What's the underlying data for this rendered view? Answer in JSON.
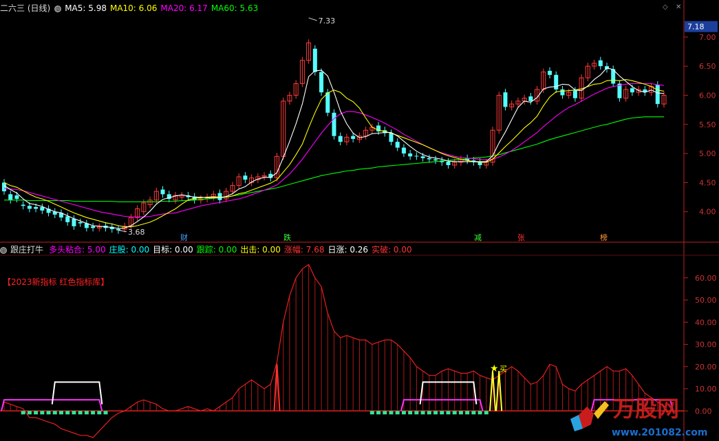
{
  "main_header": {
    "stock": "二六三 (日线)",
    "ma5_label": "MA5: 5.98",
    "ma10_label": "MA10: 6.06",
    "ma20_label": "MA20: 6.17",
    "ma60_label": "MA60: 5.63",
    "colors": {
      "ma5": "#ffffff",
      "ma10": "#ffff00",
      "ma20": "#ff00ff",
      "ma60": "#00ff00"
    }
  },
  "price_axis": {
    "current_price": "7.18",
    "ticks": [
      "7.00",
      "6.50",
      "6.00",
      "5.50",
      "5.00",
      "4.50",
      "4.00"
    ],
    "tick_values": [
      7.0,
      6.5,
      6.0,
      5.5,
      5.0,
      4.5,
      4.0
    ]
  },
  "price_annotations": {
    "high": "7.33",
    "low": "3.68"
  },
  "event_tags": [
    {
      "text": "财",
      "color": "#3fa7ff"
    },
    {
      "text": "跌",
      "color": "#33ff33"
    },
    {
      "text": "减",
      "color": "#33ff33"
    },
    {
      "text": "张",
      "color": "#ff3333"
    },
    {
      "text": "榜",
      "color": "#ff9933"
    }
  ],
  "indicator_header": {
    "name": "跟庄打牛",
    "items": [
      {
        "label": "多头粘合: 5.00",
        "color": "#ff00ff"
      },
      {
        "label": "庄股: 0.00",
        "color": "#00ffff"
      },
      {
        "label": "目标: 0.00",
        "color": "#ffffff"
      },
      {
        "label": "跟踪: 0.00",
        "color": "#00ff00"
      },
      {
        "label": "出击: 0.00",
        "color": "#ffff00"
      },
      {
        "label": "涨幅: 7.68",
        "color": "#ff3333"
      },
      {
        "label": "日涨: 0.26",
        "color": "#ffffff"
      },
      {
        "label": "实破: 0.00",
        "color": "#ff3333"
      }
    ]
  },
  "indicator_note": "【2023新指标 红色指标库】",
  "indicator_axis": {
    "ticks": [
      "60.00",
      "50.00",
      "40.00",
      "30.00",
      "20.00",
      "10.00",
      "0.00"
    ],
    "tick_values": [
      60,
      50,
      40,
      30,
      20,
      10,
      0
    ]
  },
  "buy_label": "买",
  "watermark": {
    "text": "万股网",
    "url": "www.201082.com"
  },
  "chart_data": {
    "type": "candlestick",
    "price_range": [
      3.5,
      7.4
    ],
    "indicator_range": [
      -12,
      68
    ],
    "close": [
      4.35,
      4.2,
      4.22,
      4.1,
      4.05,
      4.05,
      4.02,
      3.98,
      3.95,
      3.9,
      3.82,
      3.75,
      3.8,
      3.72,
      3.72,
      3.74,
      3.72,
      3.7,
      3.68,
      3.75,
      3.9,
      4.05,
      4.15,
      4.2,
      4.35,
      4.3,
      4.22,
      4.28,
      4.28,
      4.25,
      4.2,
      4.22,
      4.25,
      4.3,
      4.2,
      4.35,
      4.45,
      4.6,
      4.55,
      4.58,
      4.6,
      4.62,
      4.58,
      4.95,
      5.9,
      6.0,
      6.2,
      6.6,
      6.9,
      6.4,
      6.05,
      5.7,
      5.3,
      5.2,
      5.28,
      5.25,
      5.3,
      5.4,
      5.45,
      5.38,
      5.35,
      5.2,
      5.1,
      5.0,
      4.95,
      4.95,
      4.92,
      4.9,
      4.88,
      4.85,
      4.8,
      4.85,
      4.9,
      4.88,
      4.85,
      4.8,
      4.85,
      5.4,
      6.0,
      5.8,
      5.85,
      5.9,
      5.95,
      5.9,
      6.1,
      6.4,
      6.35,
      6.1,
      6.0,
      6.05,
      5.95,
      6.3,
      6.5,
      6.55,
      6.5,
      6.45,
      6.2,
      5.95,
      6.1,
      6.05,
      6.1,
      6.05,
      6.15,
      5.85,
      6.0
    ],
    "open": [
      4.5,
      4.3,
      4.28,
      4.12,
      4.1,
      4.08,
      4.08,
      4.05,
      4.0,
      3.98,
      3.92,
      3.88,
      3.82,
      3.8,
      3.75,
      3.72,
      3.76,
      3.74,
      3.7,
      3.7,
      3.75,
      3.9,
      4.0,
      4.12,
      4.2,
      4.38,
      4.3,
      4.2,
      4.25,
      4.28,
      4.26,
      4.2,
      4.22,
      4.25,
      4.32,
      4.22,
      4.35,
      4.45,
      4.62,
      4.5,
      4.55,
      4.6,
      4.65,
      4.58,
      4.95,
      5.9,
      6.0,
      6.2,
      6.6,
      6.8,
      6.4,
      6.05,
      5.7,
      5.3,
      5.2,
      5.3,
      5.24,
      5.3,
      5.4,
      5.48,
      5.4,
      5.35,
      5.2,
      5.1,
      5.0,
      4.96,
      4.95,
      4.92,
      4.9,
      4.88,
      4.86,
      4.8,
      4.85,
      4.92,
      4.88,
      4.86,
      4.8,
      4.85,
      5.4,
      6.05,
      5.8,
      5.85,
      5.9,
      5.98,
      5.9,
      6.1,
      6.42,
      6.35,
      6.1,
      6.0,
      6.08,
      5.95,
      6.3,
      6.5,
      6.6,
      6.5,
      6.45,
      6.2,
      5.95,
      6.12,
      6.05,
      6.1,
      6.05,
      6.18,
      5.85
    ],
    "ma5": [
      4.45,
      4.38,
      4.32,
      4.22,
      4.14,
      4.12,
      4.09,
      4.04,
      4.0,
      3.98,
      3.93,
      3.88,
      3.84,
      3.8,
      3.76,
      3.75,
      3.74,
      3.73,
      3.71,
      3.72,
      3.76,
      3.83,
      3.91,
      4.01,
      4.13,
      4.21,
      4.24,
      4.27,
      4.29,
      4.27,
      4.25,
      4.25,
      4.24,
      4.24,
      4.24,
      4.26,
      4.31,
      4.39,
      4.43,
      4.51,
      4.56,
      4.59,
      4.59,
      4.67,
      4.93,
      5.21,
      5.51,
      5.85,
      6.32,
      6.42,
      6.43,
      6.33,
      6.05,
      5.73,
      5.51,
      5.35,
      5.27,
      5.29,
      5.34,
      5.35,
      5.36,
      5.36,
      5.3,
      5.21,
      5.12,
      5.04,
      4.98,
      4.94,
      4.92,
      4.9,
      4.87,
      4.86,
      4.86,
      4.86,
      4.86,
      4.86,
      4.86,
      4.96,
      5.18,
      5.37,
      5.58,
      5.79,
      5.9,
      5.88,
      5.96,
      6.11,
      6.14,
      6.15,
      6.19,
      6.18,
      6.09,
      6.08,
      6.16,
      6.27,
      6.35,
      6.47,
      6.44,
      6.33,
      6.24,
      6.15,
      6.08,
      6.05,
      6.09,
      6.04,
      6.03
    ],
    "ma10": [
      4.5,
      4.45,
      4.42,
      4.36,
      4.3,
      4.25,
      4.22,
      4.18,
      4.13,
      4.08,
      4.03,
      3.98,
      3.94,
      3.9,
      3.87,
      3.84,
      3.81,
      3.79,
      3.76,
      3.74,
      3.74,
      3.76,
      3.79,
      3.82,
      3.87,
      3.93,
      3.99,
      4.05,
      4.13,
      4.2,
      4.23,
      4.24,
      4.25,
      4.26,
      4.25,
      4.25,
      4.27,
      4.31,
      4.33,
      4.37,
      4.41,
      4.45,
      4.49,
      4.55,
      4.68,
      4.81,
      4.98,
      5.16,
      5.44,
      5.7,
      5.93,
      6.04,
      6.09,
      6.05,
      5.95,
      5.89,
      5.78,
      5.61,
      5.45,
      5.4,
      5.38,
      5.35,
      5.31,
      5.27,
      5.23,
      5.19,
      5.15,
      5.1,
      5.05,
      5.0,
      4.96,
      4.93,
      4.9,
      4.88,
      4.86,
      4.85,
      4.85,
      4.9,
      5.01,
      5.12,
      5.22,
      5.33,
      5.44,
      5.53,
      5.64,
      5.82,
      5.97,
      6.06,
      6.07,
      6.08,
      6.09,
      6.11,
      6.15,
      6.19,
      6.2,
      6.25,
      6.26,
      6.25,
      6.27,
      6.25,
      6.22,
      6.19,
      6.15,
      6.09,
      6.07
    ],
    "ma20": [
      4.4,
      4.39,
      4.38,
      4.36,
      4.33,
      4.3,
      4.27,
      4.24,
      4.21,
      4.18,
      4.15,
      4.12,
      4.09,
      4.06,
      4.03,
      4.0,
      3.98,
      3.96,
      3.94,
      3.92,
      3.91,
      3.91,
      3.91,
      3.92,
      3.94,
      3.96,
      3.97,
      3.98,
      4.01,
      4.04,
      4.07,
      4.1,
      4.12,
      4.14,
      4.16,
      4.18,
      4.2,
      4.22,
      4.25,
      4.29,
      4.33,
      4.37,
      4.41,
      4.46,
      4.55,
      4.65,
      4.77,
      4.9,
      5.05,
      5.2,
      5.35,
      5.48,
      5.6,
      5.68,
      5.72,
      5.72,
      5.7,
      5.66,
      5.62,
      5.57,
      5.52,
      5.46,
      5.4,
      5.33,
      5.27,
      5.21,
      5.15,
      5.1,
      5.05,
      5.01,
      4.98,
      4.95,
      4.93,
      4.92,
      4.91,
      4.9,
      4.89,
      4.9,
      4.94,
      4.99,
      5.05,
      5.12,
      5.2,
      5.28,
      5.36,
      5.46,
      5.55,
      5.64,
      5.72,
      5.79,
      5.84,
      5.9,
      5.96,
      6.02,
      6.07,
      6.12,
      6.15,
      6.17,
      6.19,
      6.2,
      6.2,
      6.2,
      6.2,
      6.18,
      6.17
    ],
    "ma60": [
      4.2,
      4.2,
      4.2,
      4.2,
      4.19,
      4.19,
      4.19,
      4.19,
      4.19,
      4.19,
      4.19,
      4.18,
      4.18,
      4.18,
      4.18,
      4.18,
      4.18,
      4.18,
      4.17,
      4.17,
      4.17,
      4.17,
      4.17,
      4.17,
      4.17,
      4.18,
      4.18,
      4.18,
      4.19,
      4.19,
      4.2,
      4.21,
      4.22,
      4.23,
      4.24,
      4.25,
      4.27,
      4.29,
      4.31,
      4.33,
      4.35,
      4.37,
      4.39,
      4.41,
      4.44,
      4.47,
      4.5,
      4.53,
      4.56,
      4.59,
      4.62,
      4.64,
      4.66,
      4.68,
      4.7,
      4.71,
      4.73,
      4.74,
      4.75,
      4.77,
      4.78,
      4.79,
      4.8,
      4.81,
      4.82,
      4.83,
      4.84,
      4.85,
      4.86,
      4.87,
      4.88,
      4.89,
      4.9,
      4.91,
      4.92,
      4.93,
      4.94,
      4.96,
      4.98,
      5.01,
      5.04,
      5.07,
      5.1,
      5.13,
      5.16,
      5.2,
      5.24,
      5.27,
      5.3,
      5.33,
      5.36,
      5.39,
      5.42,
      5.45,
      5.48,
      5.5,
      5.53,
      5.56,
      5.59,
      5.61,
      5.62,
      5.63,
      5.63,
      5.63,
      5.63
    ],
    "indicator_rise": [
      4,
      3,
      2,
      1,
      -3,
      -3,
      -4,
      -5,
      -6,
      -8,
      -9,
      -10,
      -11,
      -11,
      -12,
      -9,
      -6,
      -3,
      -1,
      0,
      2,
      4,
      5,
      4,
      3,
      1,
      0,
      0,
      1,
      2,
      1,
      0,
      1,
      0,
      2,
      4,
      6,
      10,
      12,
      14,
      12,
      10,
      12,
      22,
      40,
      52,
      60,
      64,
      66,
      60,
      56,
      44,
      36,
      33,
      34,
      33,
      32,
      32,
      30,
      31,
      32,
      32,
      30,
      27,
      24,
      20,
      18,
      16,
      16,
      18,
      19,
      18,
      17,
      17,
      18,
      16,
      15,
      14,
      16,
      18,
      20,
      18,
      15,
      12,
      13,
      16,
      21,
      20,
      12,
      10,
      9,
      12,
      14,
      16,
      18,
      20,
      18,
      18,
      19,
      16,
      12,
      8,
      6,
      4,
      2
    ],
    "magenta_band": [
      [
        0,
        15
      ],
      [
        63,
        75
      ],
      [
        93,
        105
      ]
    ],
    "white_band": [
      [
        8,
        15
      ],
      [
        66,
        74
      ]
    ],
    "green_bars_range": [
      [
        3,
        16
      ],
      [
        58,
        76
      ]
    ]
  }
}
